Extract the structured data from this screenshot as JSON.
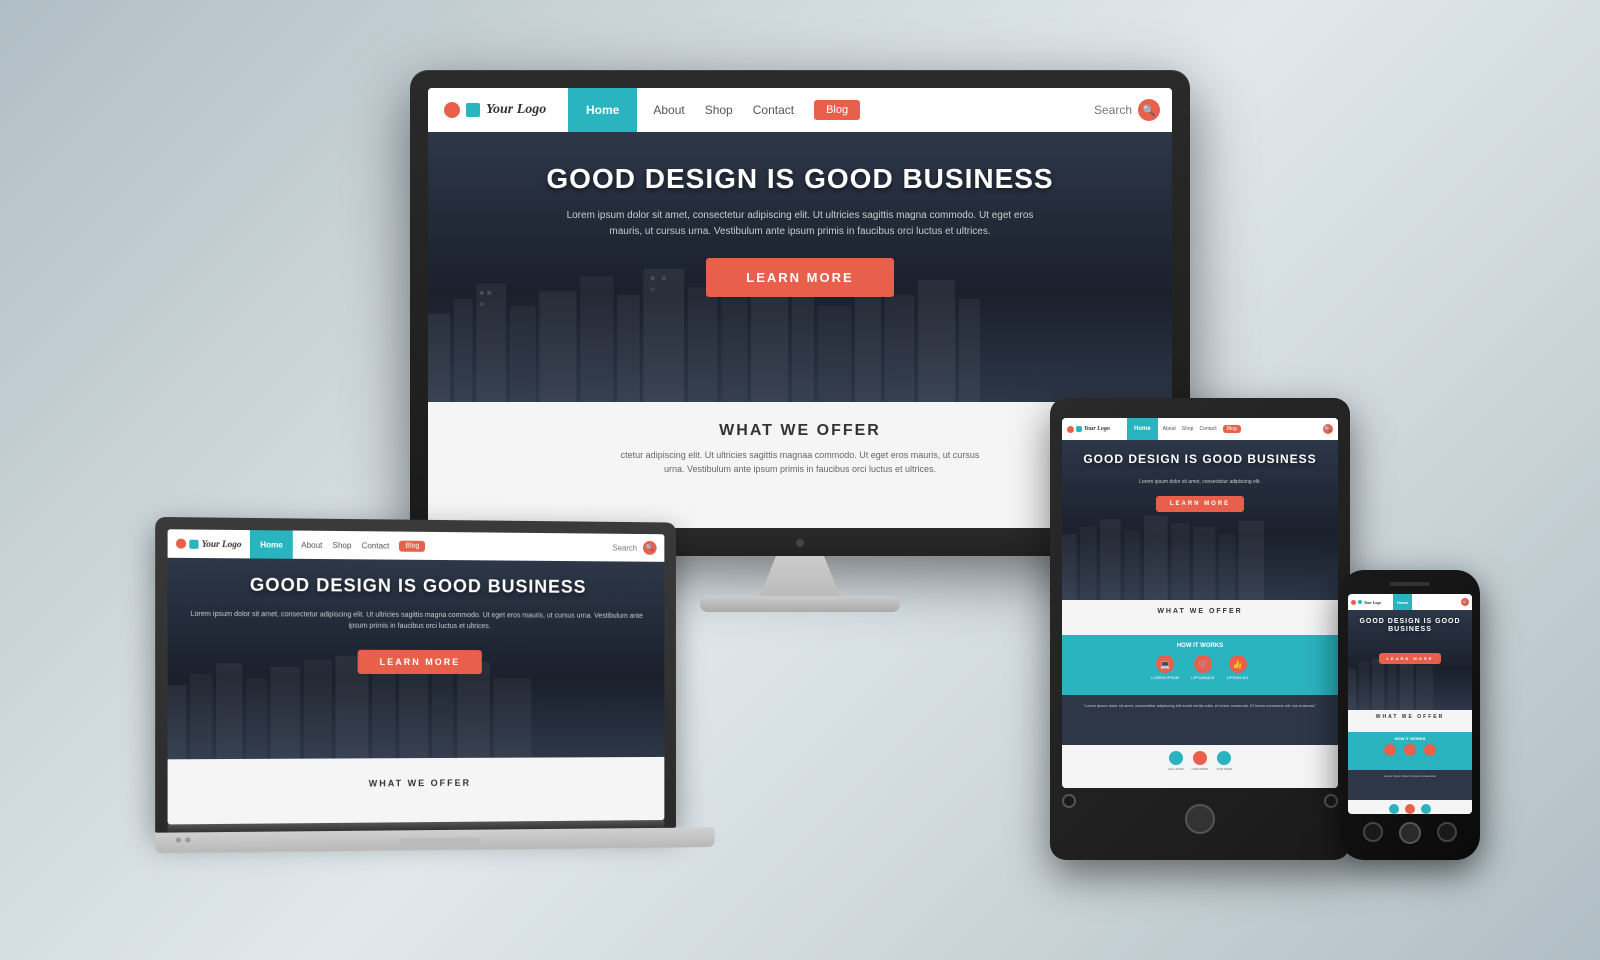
{
  "background": {
    "gradient_start": "#b0bec5",
    "gradient_end": "#cfd8dc"
  },
  "website": {
    "navbar": {
      "logo_text": "Your Logo",
      "nav_home": "Home",
      "nav_about": "About",
      "nav_shop": "Shop",
      "nav_contact": "Contact",
      "nav_blog": "Blog",
      "nav_search": "Search"
    },
    "hero": {
      "title": "GOOD DESIGN IS GOOD BUSINESS",
      "subtitle": "Lorem ipsum dolor sit amet, consectetur adipiscing elit. Ut ultricies sagittis magna commodo. Ut eget eros mauris, ut cursus urna. Vestibulum ante ipsum primis in faucibus orci luctus et ultrices.",
      "cta_button": "LEARN MORE"
    },
    "section_what_we_offer": {
      "title": "WHAT WE OFFER",
      "text": "ctetur adipiscing elit. Ut ultricies sagittis magnaa commodo. Ut eget eros mauris, ut cursus urna. Vestibulum ante ipsum primis in faucibus orci luctus et ultrices."
    }
  },
  "devices": {
    "monitor": {
      "label": "Desktop Monitor"
    },
    "laptop": {
      "label": "Laptop"
    },
    "tablet": {
      "label": "Tablet"
    },
    "phone": {
      "label": "Smartphone"
    }
  },
  "colors": {
    "teal": "#2ab4c0",
    "orange": "#e8604c",
    "dark_bg": "#2d3748",
    "text_light": "#ffffff",
    "text_gray": "#555555"
  }
}
